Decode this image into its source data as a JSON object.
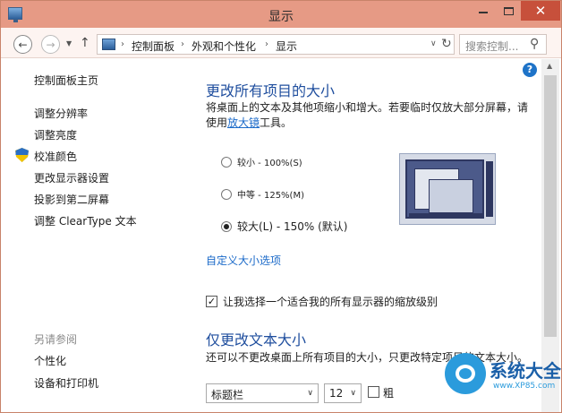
{
  "window": {
    "title": "显示",
    "close_glyph": "✕"
  },
  "nav": {
    "back_glyph": "←",
    "forward_glyph": "→",
    "up_glyph": "↑",
    "breadcrumb": [
      "控制面板",
      "外观和个性化",
      "显示"
    ],
    "breadcrumb_sep": "›",
    "search_placeholder": "搜索控制..."
  },
  "sidebar": {
    "home": "控制面板主页",
    "items": [
      "调整分辨率",
      "调整亮度",
      "校准颜色",
      "更改显示器设置",
      "投影到第二屏幕",
      "调整 ClearType 文本"
    ],
    "see_also_title": "另请参阅",
    "see_also": [
      "个性化",
      "设备和打印机"
    ]
  },
  "main": {
    "heading1": "更改所有项目的大小",
    "desc1_line1": "将桌面上的文本及其他项缩小和增大。若要临时仅放大部分屏幕，请",
    "desc1_line2_pre": "使用",
    "desc1_link": "放大镜",
    "desc1_line2_post": "工具。",
    "options": [
      {
        "label": "较小 - 100%(S)",
        "selected": false
      },
      {
        "label": "中等 - 125%(M)",
        "selected": false
      },
      {
        "label": "较大(L) - 150% (默认)",
        "selected": true
      }
    ],
    "custom_link": "自定义大小选项",
    "checkbox_label": "让我选择一个适合我的所有显示器的缩放级别",
    "checkbox_checked": true,
    "heading2": "仅更改文本大小",
    "desc2": "还可以不更改桌面上所有项目的大小，只更改特定项目的文本大小。",
    "item_select": "标题栏",
    "size_select": "12",
    "bold_label": "粗"
  },
  "watermark": {
    "text": "系统大全",
    "sub": "www.XP85.com"
  },
  "help_glyph": "?"
}
